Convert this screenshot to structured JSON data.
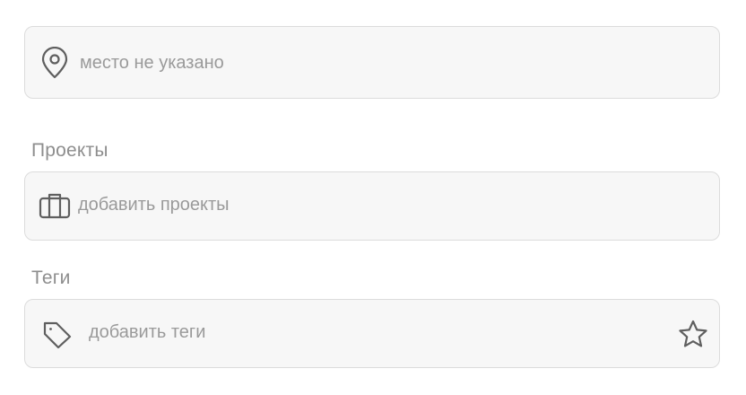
{
  "location": {
    "icon": "map-pin-icon",
    "placeholder": "место не указано"
  },
  "projects": {
    "label": "Проекты",
    "icon": "briefcase-icon",
    "placeholder": "добавить проекты"
  },
  "tags": {
    "label": "Теги",
    "icon": "tag-icon",
    "placeholder": "добавить теги",
    "favorite_icon": "star-icon"
  },
  "colors": {
    "field_background": "#f7f7f7",
    "field_border": "#dcdcdc",
    "icon": "#5f5f5f",
    "placeholder_text": "#9a9a9a",
    "label_text": "#8e8e8e"
  }
}
